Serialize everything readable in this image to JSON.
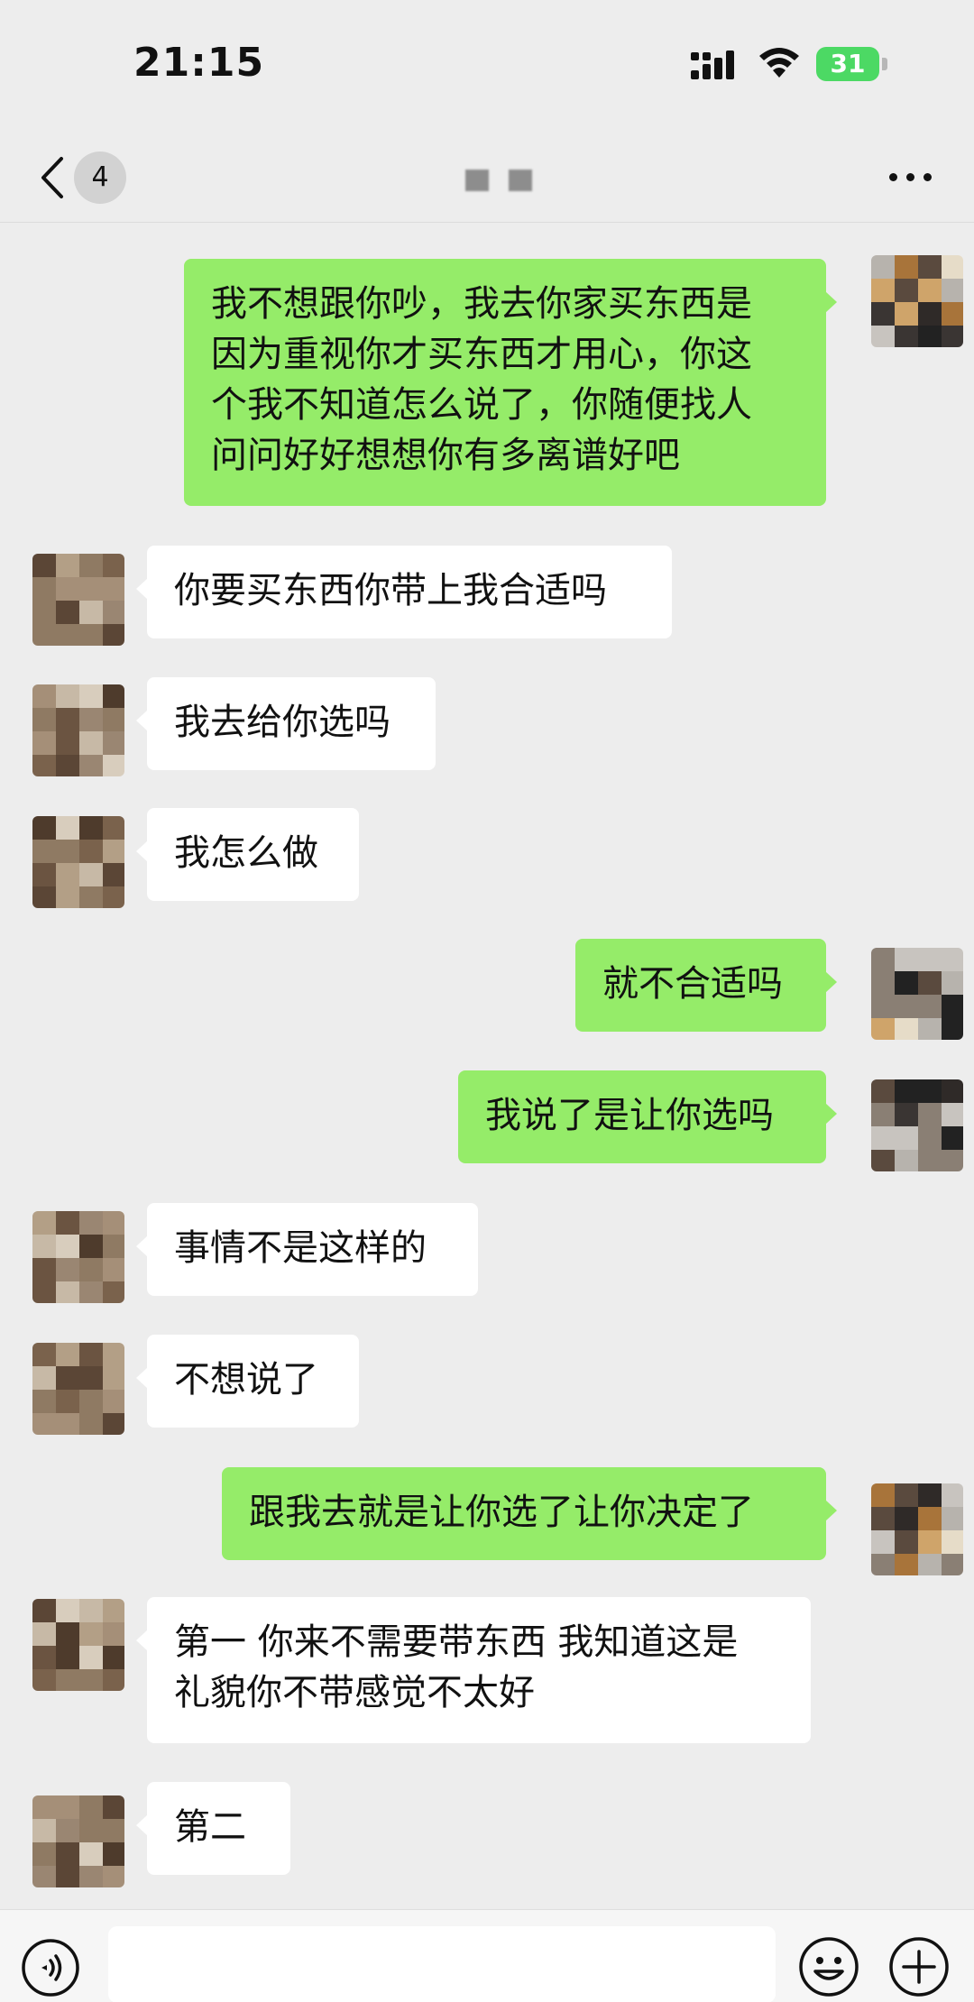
{
  "status_bar": {
    "time": "21:15",
    "battery_level": "31",
    "battery_charging": true,
    "icons": [
      "cellular-signal-icon",
      "wifi-icon",
      "battery-icon"
    ]
  },
  "nav": {
    "unread_count": "4",
    "title_obscured": true,
    "icons": [
      "back-chevron-icon",
      "more-icon"
    ]
  },
  "messages": [
    {
      "sender": "me",
      "text": "我不想跟你吵，我去你家买东西是\n因为重视你才买东西才用心，你这\n个我不知道怎么说了，你随便找人\n问问好好想想你有多离谱好吧"
    },
    {
      "sender": "other",
      "text": "你要买东西你带上我合适吗"
    },
    {
      "sender": "other",
      "text": "我去给你选吗"
    },
    {
      "sender": "other",
      "text": "我怎么做"
    },
    {
      "sender": "me",
      "text": "就不合适吗"
    },
    {
      "sender": "me",
      "text": "我说了是让你选吗"
    },
    {
      "sender": "other",
      "text": "事情不是这样的"
    },
    {
      "sender": "other",
      "text": "不想说了"
    },
    {
      "sender": "me",
      "text": "跟我去就是让你选了让你决定了"
    },
    {
      "sender": "other",
      "text": "第一 你来不需要带东西 我知道这是\n礼貌你不带感觉不太好"
    },
    {
      "sender": "other",
      "text": "第二"
    }
  ],
  "input_bar": {
    "placeholder": "",
    "icons": [
      "voice-icon",
      "emoji-icon",
      "add-icon"
    ]
  },
  "colors": {
    "background": "#ededed",
    "outgoing_bubble": "#95ec69",
    "incoming_bubble": "#ffffff",
    "battery": "#4cd964"
  }
}
